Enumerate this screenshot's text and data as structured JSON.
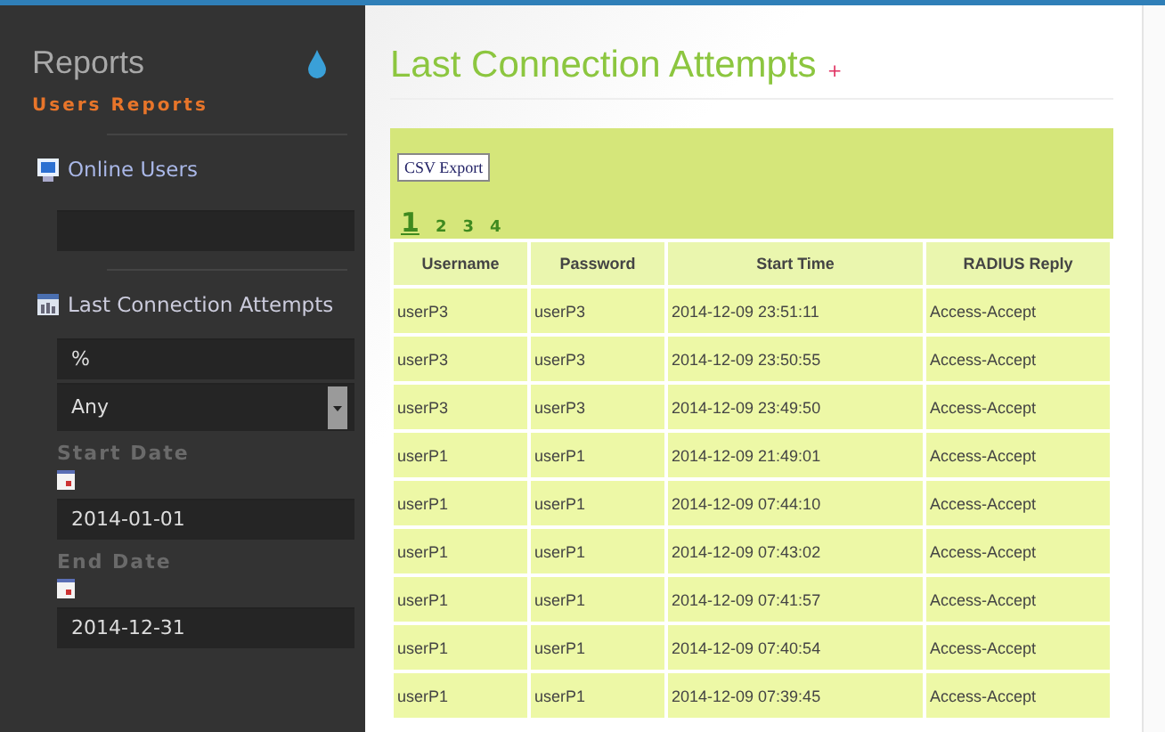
{
  "sidebar": {
    "title": "Reports",
    "section": "Users Reports",
    "links": [
      {
        "label": "Online Users",
        "kind": "monitor",
        "has_field": true
      },
      {
        "label": "Last Connection Attempts",
        "kind": "chart"
      }
    ],
    "filters": [
      {
        "kind": "text",
        "value": "%"
      },
      {
        "kind": "select",
        "value": "Any"
      },
      {
        "kind": "date",
        "label": "Start Date",
        "value": "2014-01-01"
      },
      {
        "kind": "date",
        "label": "End Date",
        "value": "2014-12-31"
      }
    ]
  },
  "main": {
    "title": "Last Connection Attempts",
    "title_mark": "+",
    "export_button": "CSV Export",
    "pages": [
      {
        "label": "1",
        "selected": true
      },
      {
        "label": "2",
        "selected": false
      },
      {
        "label": "3",
        "selected": false
      },
      {
        "label": "4",
        "selected": false
      }
    ],
    "table": {
      "columns": [
        "Username",
        "Password",
        "Start Time",
        "RADIUS Reply"
      ],
      "rows": [
        [
          "userP3",
          "userP3",
          "2014-12-09 23:51:11",
          "Access-Accept"
        ],
        [
          "userP3",
          "userP3",
          "2014-12-09 23:50:55",
          "Access-Accept"
        ],
        [
          "userP3",
          "userP3",
          "2014-12-09 23:49:50",
          "Access-Accept"
        ],
        [
          "userP1",
          "userP1",
          "2014-12-09 21:49:01",
          "Access-Accept"
        ],
        [
          "userP1",
          "userP1",
          "2014-12-09 07:44:10",
          "Access-Accept"
        ],
        [
          "userP1",
          "userP1",
          "2014-12-09 07:43:02",
          "Access-Accept"
        ],
        [
          "userP1",
          "userP1",
          "2014-12-09 07:41:57",
          "Access-Accept"
        ],
        [
          "userP1",
          "userP1",
          "2014-12-09 07:40:54",
          "Access-Accept"
        ],
        [
          "userP1",
          "userP1",
          "2014-12-09 07:39:45",
          "Access-Accept"
        ]
      ]
    }
  }
}
